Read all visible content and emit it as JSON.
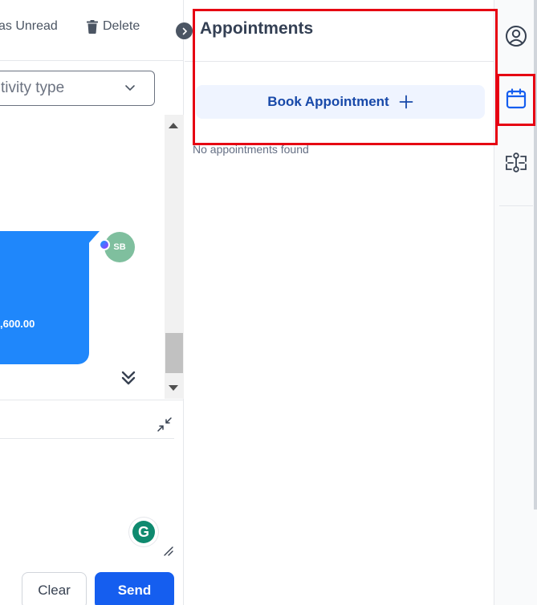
{
  "toolbar": {
    "mark_unread_label": "as Unread",
    "delete_label": "Delete"
  },
  "filter": {
    "activity_type_placeholder": "tivity type"
  },
  "conversation": {
    "avatar_initials": "SB",
    "message_amount": ",600.00"
  },
  "compose": {
    "clear_label": "Clear",
    "send_label": "Send",
    "grammarly_letter": "G"
  },
  "appointments": {
    "title": "Appointments",
    "book_button_label": "Book Appointment",
    "empty_text": "No appointments found"
  },
  "icons": {
    "trash": "trash-icon",
    "chevron": "chevron-down-icon",
    "collapse_toggle": "chevron-right-icon",
    "contact": "user-circle-icon",
    "calendar": "calendar-icon",
    "automation": "workflow-icon",
    "plus": "plus-icon",
    "double_down": "double-chevron-down-icon",
    "minimize": "minimize-arrows-icon"
  },
  "colors": {
    "primary": "#155eef",
    "bubble": "#1f87fb",
    "highlight": "#e60012",
    "book_bg": "#eff4ff",
    "book_text": "#1849a9"
  }
}
